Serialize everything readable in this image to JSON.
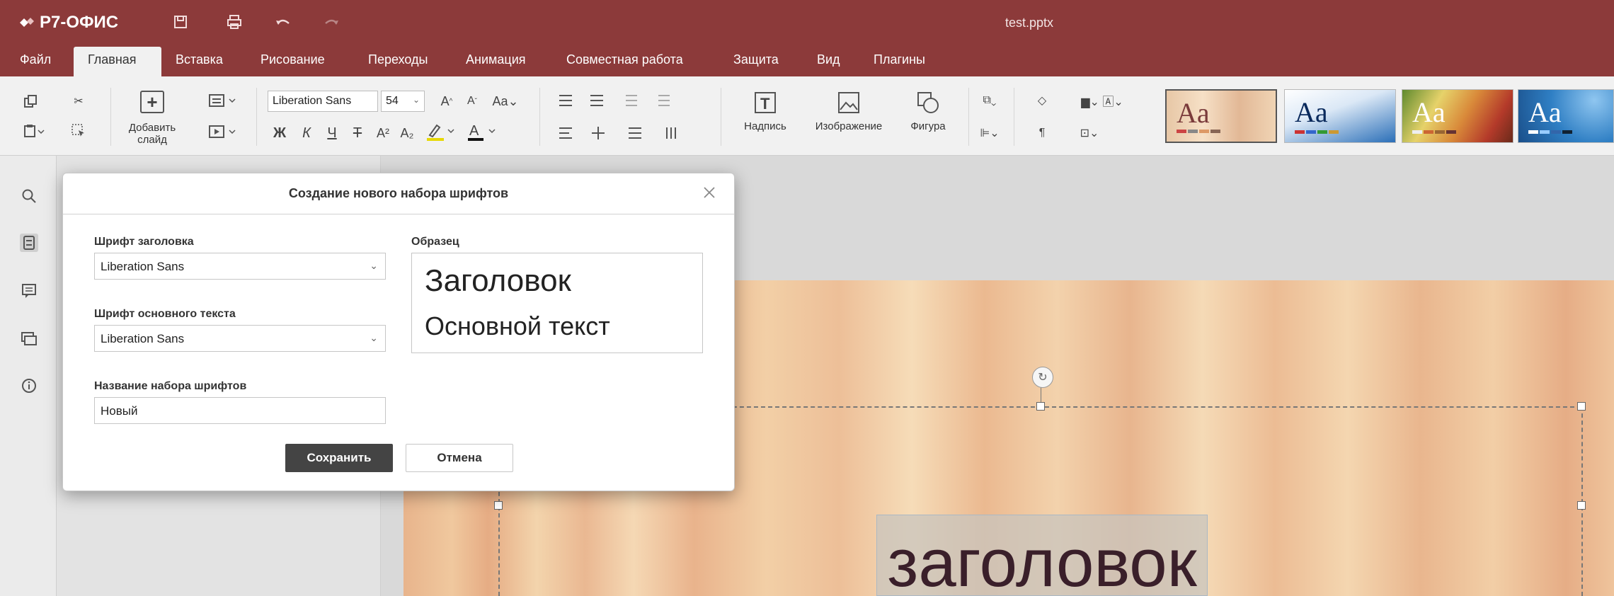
{
  "app": {
    "brand": "Р7-ОФИС",
    "doc_title": "test.pptx"
  },
  "menu": {
    "items": [
      "Файл",
      "Главная",
      "Вставка",
      "Рисование",
      "Переходы",
      "Анимация",
      "Совместная работа",
      "Защита",
      "Вид",
      "Плагины"
    ],
    "active": "Главная"
  },
  "toolbar": {
    "add_slide_label": "Добавить слайд",
    "font_name": "Liberation Sans",
    "font_size": "54",
    "inscription_label": "Надпись",
    "image_label": "Изображение",
    "shape_label": "Фигура",
    "format_buttons": {
      "bold": "Ж",
      "italic": "К",
      "underline": "Ч",
      "strike": "Т"
    },
    "themes": [
      "Aa",
      "Aa",
      "Aa",
      "Aa"
    ]
  },
  "slide": {
    "title_text": "заголовок"
  },
  "dialog": {
    "title": "Создание нового набора шрифтов",
    "heading_font_label": "Шрифт заголовка",
    "heading_font_value": "Liberation Sans",
    "body_font_label": "Шрифт основного текста",
    "body_font_value": "Liberation Sans",
    "set_name_label": "Название набора шрифтов",
    "set_name_value": "Новый",
    "sample_label": "Образец",
    "sample_heading": "Заголовок",
    "sample_body": "Основной текст",
    "save_label": "Сохранить",
    "cancel_label": "Отмена"
  },
  "colors": {
    "brand": "#8c3a3a",
    "toolbar_bg": "#f1f1f1",
    "primary_button": "#444444"
  }
}
